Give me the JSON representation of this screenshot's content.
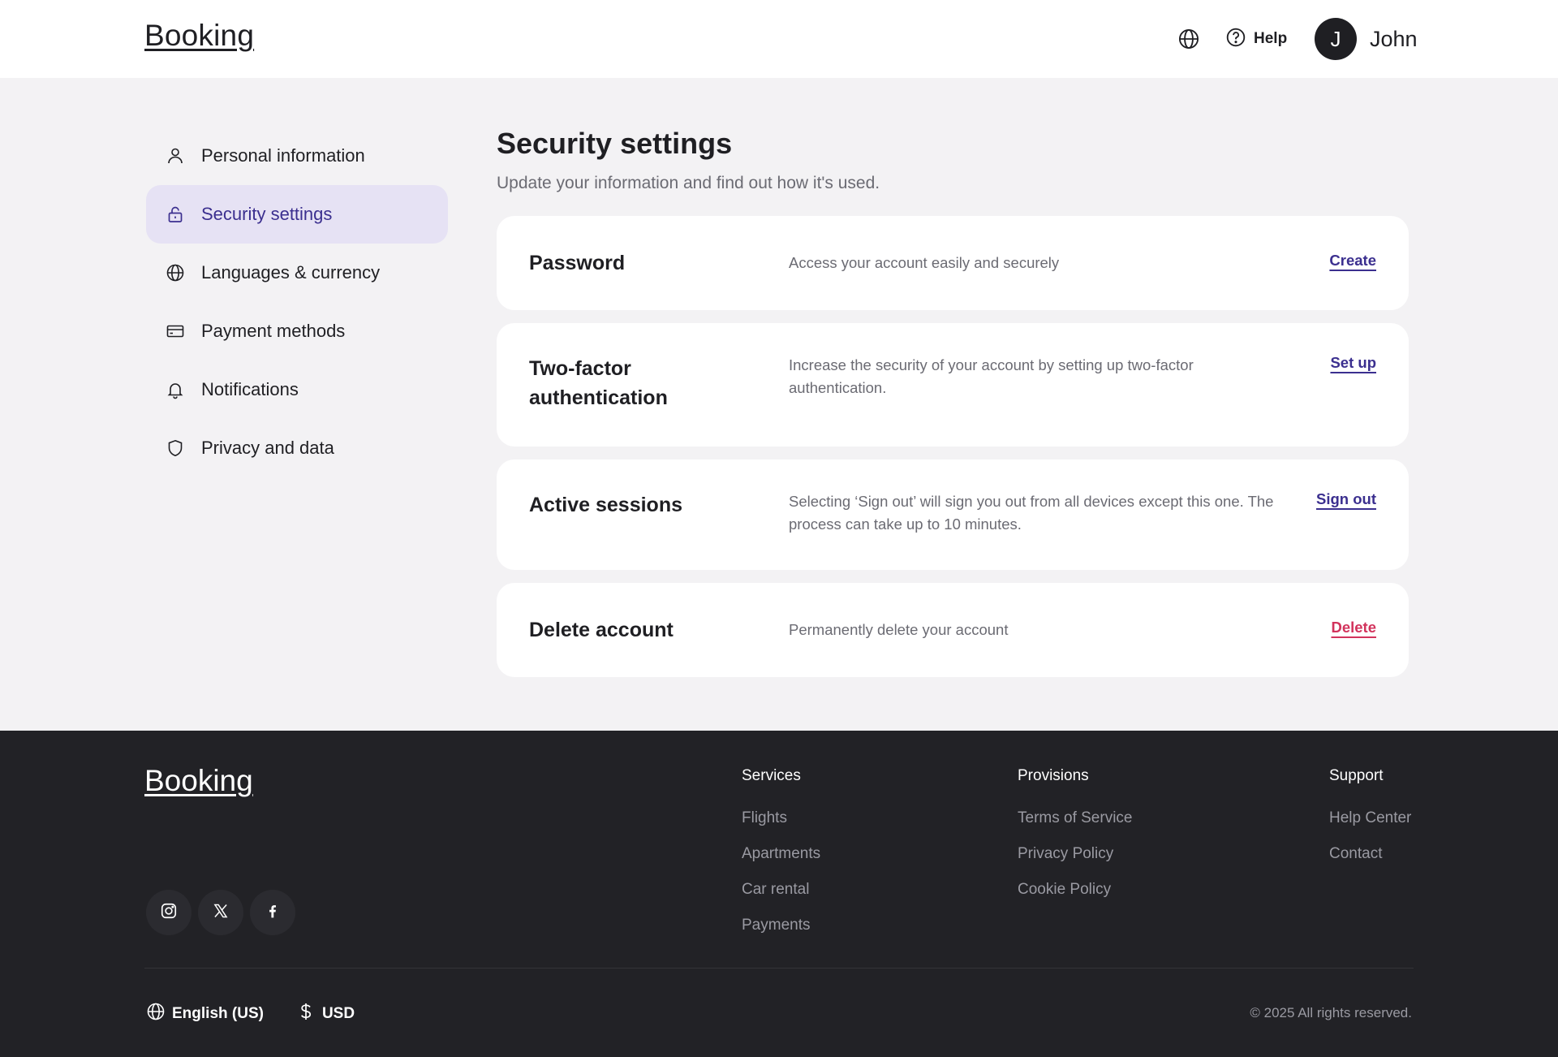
{
  "header": {
    "brand": "Booking",
    "help_label": "Help",
    "user": {
      "initial": "J",
      "name": "John"
    }
  },
  "sidebar": {
    "items": [
      {
        "label": "Personal information",
        "icon": "user-icon"
      },
      {
        "label": "Security settings",
        "icon": "lock-icon",
        "active": true
      },
      {
        "label": "Languages & currency",
        "icon": "globe-icon"
      },
      {
        "label": "Payment methods",
        "icon": "credit-card-icon"
      },
      {
        "label": "Notifications",
        "icon": "bell-icon"
      },
      {
        "label": "Privacy and data",
        "icon": "shield-icon"
      }
    ]
  },
  "main": {
    "title": "Security settings",
    "subtitle": "Update your information and find out how it's used.",
    "cards": [
      {
        "title": "Password",
        "description": "Access your account easily and securely",
        "action": "Create"
      },
      {
        "title": "Two-factor authentication",
        "description": "Increase the security of your account by setting up two-factor authentication.",
        "action": "Set up"
      },
      {
        "title": "Active sessions",
        "description": "Selecting ‘Sign out’ will sign you out from all devices except this one. The process can take up to 10 minutes.",
        "action": "Sign out"
      },
      {
        "title": "Delete account",
        "description": "Permanently delete your account",
        "action": "Delete"
      }
    ]
  },
  "footer": {
    "brand": "Booking",
    "columns": [
      {
        "heading": "Services",
        "links": [
          "Flights",
          "Apartments",
          "Car rental",
          "Payments"
        ]
      },
      {
        "heading": "Provisions",
        "links": [
          "Terms of Service",
          "Privacy Policy",
          "Cookie Policy"
        ]
      },
      {
        "heading": "Support",
        "links": [
          "Help Center",
          "Contact"
        ]
      }
    ],
    "language": "English (US)",
    "currency": "USD",
    "copyright": "© 2025 All rights reserved.",
    "socials": [
      "instagram-icon",
      "x-icon",
      "facebook-icon"
    ]
  },
  "colors": {
    "accent": "#3b2f8f",
    "accent_bg": "#e6e2f4",
    "danger": "#d2335c",
    "footer_bg": "#222226",
    "page_bg": "#f3f2f4"
  }
}
